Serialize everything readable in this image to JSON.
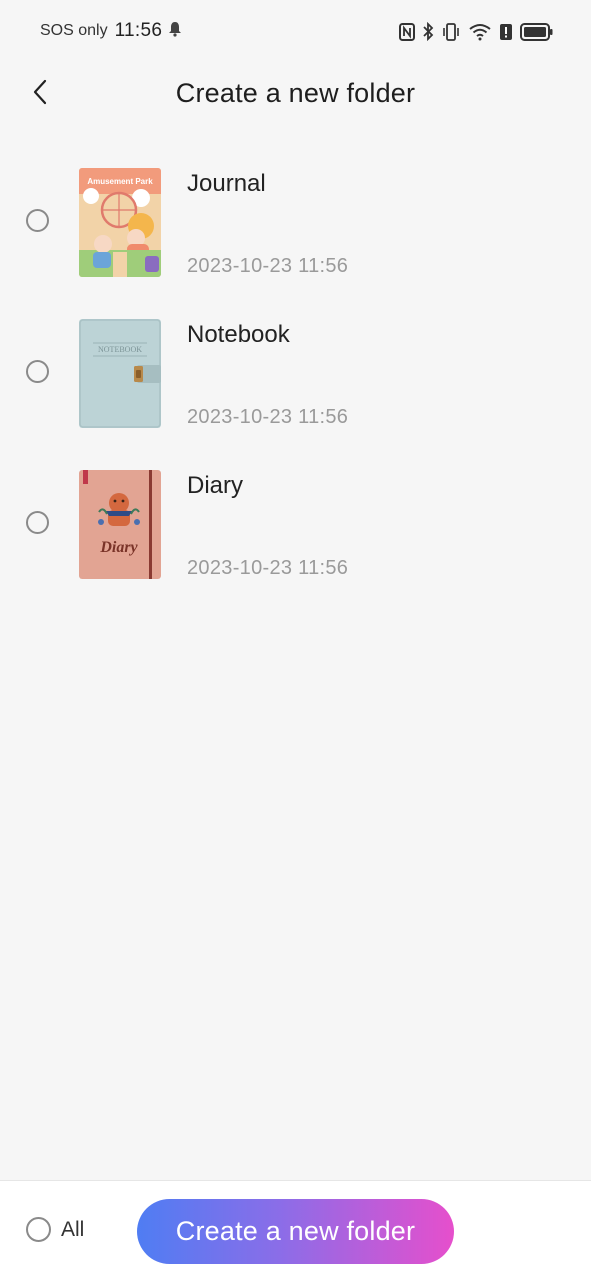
{
  "status_bar": {
    "carrier": "SOS only",
    "time": "11:56",
    "icons": [
      "bell-icon",
      "nfc-icon",
      "bluetooth-icon",
      "vibrate-icon",
      "wifi-icon",
      "alert-icon",
      "battery-icon"
    ]
  },
  "header": {
    "title": "Create a new folder",
    "back_icon": "chevron-left-icon"
  },
  "folders": [
    {
      "name": "Journal",
      "date": "2023-10-23 11:56",
      "cover_text": "Amusement Park",
      "selected": false
    },
    {
      "name": "Notebook",
      "date": "2023-10-23 11:56",
      "cover_text": "NOTEBOOK",
      "selected": false
    },
    {
      "name": "Diary",
      "date": "2023-10-23 11:56",
      "cover_text": "Diary",
      "selected": false
    }
  ],
  "footer": {
    "select_all_label": "All",
    "create_button_label": "Create a new folder"
  },
  "colors": {
    "background": "#f6f6f6",
    "button_gradient_start": "#4f7df3",
    "button_gradient_end": "#e64fcc"
  }
}
